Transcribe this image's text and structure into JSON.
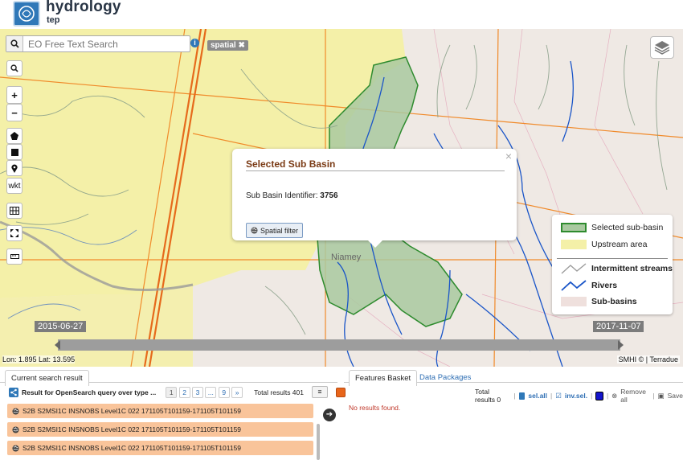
{
  "app": {
    "title": "hydrology",
    "subtitle": "tep"
  },
  "search": {
    "placeholder": "EO Free Text Search",
    "tag": "spatial ✖"
  },
  "popup": {
    "title": "Selected Sub Basin",
    "id_label": "Sub Basin Identifier:",
    "id_value": "3756",
    "button": "Spatial filter",
    "close": "×"
  },
  "map": {
    "place_label": "Niamey",
    "date_start": "2015-06-27",
    "date_end": "2017-11-07",
    "coords": "Lon: 1.895 Lat: 13.595",
    "attribution": "SMHI © | Terradue"
  },
  "legend": {
    "items": [
      "Selected sub-basin",
      "Upstream area",
      "Intermittent streams",
      "Rivers",
      "Sub-basins"
    ]
  },
  "tools": {
    "wkt": "wkt"
  },
  "results": {
    "tab": "Current search result",
    "title": "Result for OpenSearch query over type ...",
    "pages": [
      "1",
      "2",
      "3",
      "...",
      "9",
      "»"
    ],
    "total": "Total results  401",
    "items": [
      "S2B S2MSI1C INSNOBS Level1C 022 171105T101159-171105T101159",
      "S2B S2MSI1C INSNOBS Level1C 022 171105T101159-171105T101159",
      "S2B S2MSI1C INSNOBS Level1C 022 171105T101159-171105T101159"
    ]
  },
  "basket": {
    "tab_features": "Features Basket",
    "tab_packages": "Data Packages",
    "total": "Total results  0",
    "sel_all": "sel.all",
    "inv_sel": "inv.sel.",
    "remove_all": "Remove all",
    "save": "Save",
    "empty": "No results found."
  },
  "colors": {
    "accent": "#2f78b8",
    "result_bg": "#f9c49a",
    "basin": "#a9c9a0",
    "upstream": "#f4f0a8",
    "roads": "#f08a2a"
  }
}
